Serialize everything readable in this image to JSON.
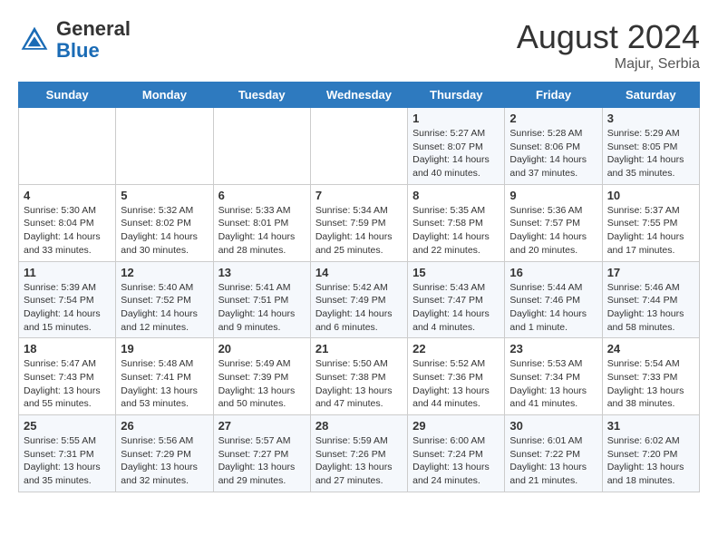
{
  "header": {
    "logo_general": "General",
    "logo_blue": "Blue",
    "month_year": "August 2024",
    "location": "Majur, Serbia"
  },
  "weekdays": [
    "Sunday",
    "Monday",
    "Tuesday",
    "Wednesday",
    "Thursday",
    "Friday",
    "Saturday"
  ],
  "weeks": [
    [
      {
        "day": "",
        "info": ""
      },
      {
        "day": "",
        "info": ""
      },
      {
        "day": "",
        "info": ""
      },
      {
        "day": "",
        "info": ""
      },
      {
        "day": "1",
        "info": "Sunrise: 5:27 AM\nSunset: 8:07 PM\nDaylight: 14 hours\nand 40 minutes."
      },
      {
        "day": "2",
        "info": "Sunrise: 5:28 AM\nSunset: 8:06 PM\nDaylight: 14 hours\nand 37 minutes."
      },
      {
        "day": "3",
        "info": "Sunrise: 5:29 AM\nSunset: 8:05 PM\nDaylight: 14 hours\nand 35 minutes."
      }
    ],
    [
      {
        "day": "4",
        "info": "Sunrise: 5:30 AM\nSunset: 8:04 PM\nDaylight: 14 hours\nand 33 minutes."
      },
      {
        "day": "5",
        "info": "Sunrise: 5:32 AM\nSunset: 8:02 PM\nDaylight: 14 hours\nand 30 minutes."
      },
      {
        "day": "6",
        "info": "Sunrise: 5:33 AM\nSunset: 8:01 PM\nDaylight: 14 hours\nand 28 minutes."
      },
      {
        "day": "7",
        "info": "Sunrise: 5:34 AM\nSunset: 7:59 PM\nDaylight: 14 hours\nand 25 minutes."
      },
      {
        "day": "8",
        "info": "Sunrise: 5:35 AM\nSunset: 7:58 PM\nDaylight: 14 hours\nand 22 minutes."
      },
      {
        "day": "9",
        "info": "Sunrise: 5:36 AM\nSunset: 7:57 PM\nDaylight: 14 hours\nand 20 minutes."
      },
      {
        "day": "10",
        "info": "Sunrise: 5:37 AM\nSunset: 7:55 PM\nDaylight: 14 hours\nand 17 minutes."
      }
    ],
    [
      {
        "day": "11",
        "info": "Sunrise: 5:39 AM\nSunset: 7:54 PM\nDaylight: 14 hours\nand 15 minutes."
      },
      {
        "day": "12",
        "info": "Sunrise: 5:40 AM\nSunset: 7:52 PM\nDaylight: 14 hours\nand 12 minutes."
      },
      {
        "day": "13",
        "info": "Sunrise: 5:41 AM\nSunset: 7:51 PM\nDaylight: 14 hours\nand 9 minutes."
      },
      {
        "day": "14",
        "info": "Sunrise: 5:42 AM\nSunset: 7:49 PM\nDaylight: 14 hours\nand 6 minutes."
      },
      {
        "day": "15",
        "info": "Sunrise: 5:43 AM\nSunset: 7:47 PM\nDaylight: 14 hours\nand 4 minutes."
      },
      {
        "day": "16",
        "info": "Sunrise: 5:44 AM\nSunset: 7:46 PM\nDaylight: 14 hours\nand 1 minute."
      },
      {
        "day": "17",
        "info": "Sunrise: 5:46 AM\nSunset: 7:44 PM\nDaylight: 13 hours\nand 58 minutes."
      }
    ],
    [
      {
        "day": "18",
        "info": "Sunrise: 5:47 AM\nSunset: 7:43 PM\nDaylight: 13 hours\nand 55 minutes."
      },
      {
        "day": "19",
        "info": "Sunrise: 5:48 AM\nSunset: 7:41 PM\nDaylight: 13 hours\nand 53 minutes."
      },
      {
        "day": "20",
        "info": "Sunrise: 5:49 AM\nSunset: 7:39 PM\nDaylight: 13 hours\nand 50 minutes."
      },
      {
        "day": "21",
        "info": "Sunrise: 5:50 AM\nSunset: 7:38 PM\nDaylight: 13 hours\nand 47 minutes."
      },
      {
        "day": "22",
        "info": "Sunrise: 5:52 AM\nSunset: 7:36 PM\nDaylight: 13 hours\nand 44 minutes."
      },
      {
        "day": "23",
        "info": "Sunrise: 5:53 AM\nSunset: 7:34 PM\nDaylight: 13 hours\nand 41 minutes."
      },
      {
        "day": "24",
        "info": "Sunrise: 5:54 AM\nSunset: 7:33 PM\nDaylight: 13 hours\nand 38 minutes."
      }
    ],
    [
      {
        "day": "25",
        "info": "Sunrise: 5:55 AM\nSunset: 7:31 PM\nDaylight: 13 hours\nand 35 minutes."
      },
      {
        "day": "26",
        "info": "Sunrise: 5:56 AM\nSunset: 7:29 PM\nDaylight: 13 hours\nand 32 minutes."
      },
      {
        "day": "27",
        "info": "Sunrise: 5:57 AM\nSunset: 7:27 PM\nDaylight: 13 hours\nand 29 minutes."
      },
      {
        "day": "28",
        "info": "Sunrise: 5:59 AM\nSunset: 7:26 PM\nDaylight: 13 hours\nand 27 minutes."
      },
      {
        "day": "29",
        "info": "Sunrise: 6:00 AM\nSunset: 7:24 PM\nDaylight: 13 hours\nand 24 minutes."
      },
      {
        "day": "30",
        "info": "Sunrise: 6:01 AM\nSunset: 7:22 PM\nDaylight: 13 hours\nand 21 minutes."
      },
      {
        "day": "31",
        "info": "Sunrise: 6:02 AM\nSunset: 7:20 PM\nDaylight: 13 hours\nand 18 minutes."
      }
    ]
  ]
}
